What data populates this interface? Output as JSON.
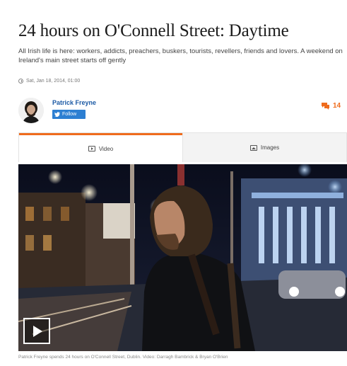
{
  "article": {
    "headline": "24 hours on O'Connell Street: Daytime",
    "standfirst": "All Irish life is here: workers, addicts, preachers, buskers, tourists, revellers, friends and lovers. A weekend on Ireland's main street starts off gently",
    "dateline": "Sat, Jan 18, 2014, 01:00"
  },
  "author": {
    "name": "Patrick Freyne",
    "follow_label": "Follow"
  },
  "comments": {
    "count": "14"
  },
  "media_tabs": [
    {
      "label": "Video"
    },
    {
      "label": "Images"
    }
  ],
  "media": {
    "caption": "Patrick Freyne spends 24 hours on O'Connell Street, Dublin. Video: Darragh Bambrick & Bryan O'Brien"
  },
  "colors": {
    "accent": "#ef6c1d",
    "link": "#1c5aa5",
    "follow_bg": "#2d7fd2"
  }
}
